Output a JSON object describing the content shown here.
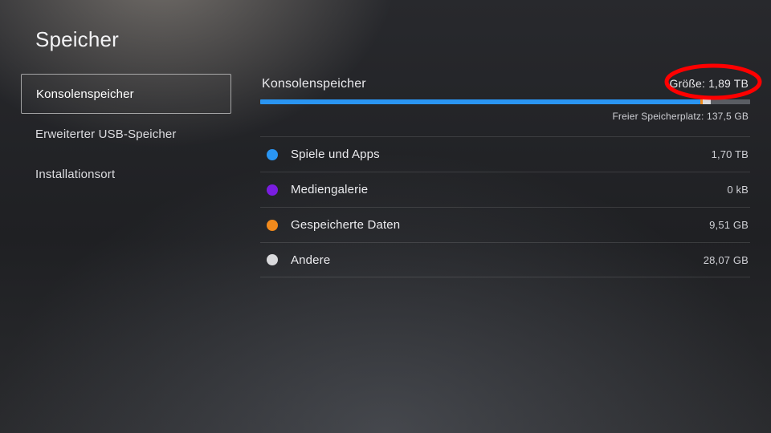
{
  "page": {
    "title": "Speicher"
  },
  "sidebar": {
    "items": [
      {
        "label": "Konsolenspeicher",
        "selected": true
      },
      {
        "label": "Erweiterter USB-Speicher",
        "selected": false
      },
      {
        "label": "Installationsort",
        "selected": false
      }
    ]
  },
  "storage": {
    "section_title": "Konsolenspeicher",
    "size_prefix": "Größe: ",
    "size_value": "1,89 TB",
    "free_prefix": "Freier Speicherplatz: ",
    "free_value": "137,5 GB",
    "categories": [
      {
        "label": "Spiele und Apps",
        "size": "1,70 TB",
        "color": "#2a95f2",
        "percent": 89.9
      },
      {
        "label": "Mediengalerie",
        "size": "0 kB",
        "color": "#7a1de0",
        "percent": 0
      },
      {
        "label": "Gespeicherte Daten",
        "size": "9,51 GB",
        "color": "#f28a1c",
        "percent": 0.5
      },
      {
        "label": "Andere",
        "size": "28,07 GB",
        "color": "#d9d9dc",
        "percent": 1.5
      }
    ],
    "free_percent": 8.1
  },
  "colors": {
    "accent": "#2a95f2",
    "annotation": "#ff0000"
  }
}
